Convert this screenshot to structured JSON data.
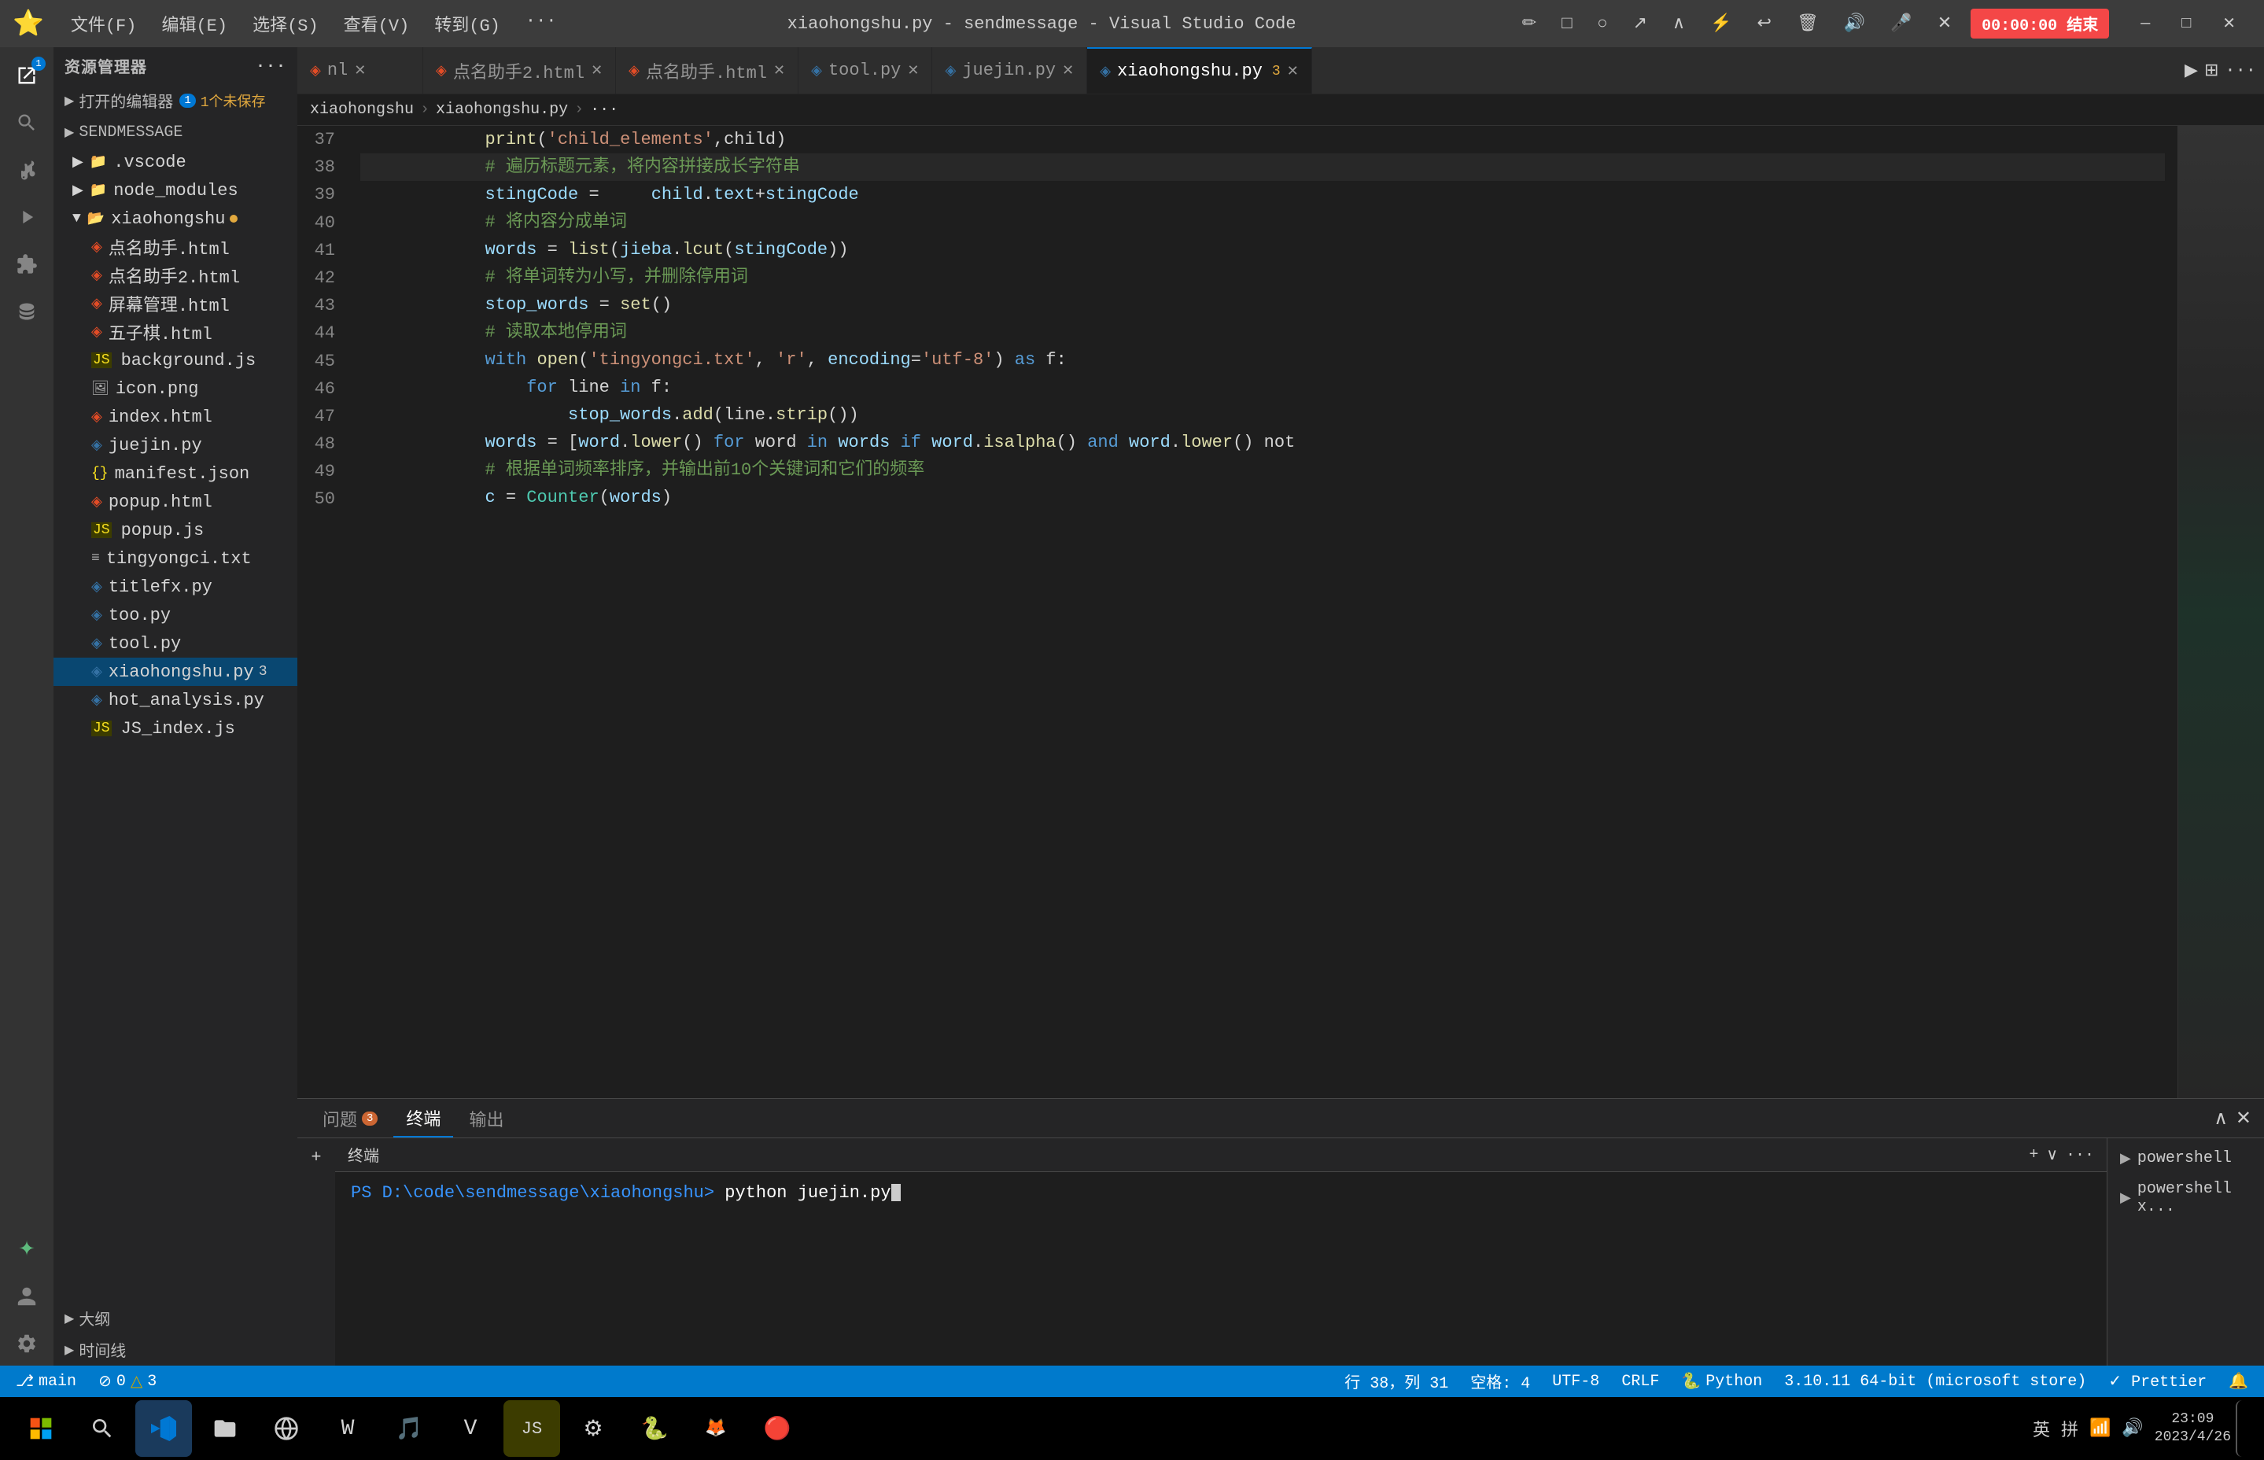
{
  "titleBar": {
    "title": "xiaohongshu.py - sendmessage - Visual Studio Code",
    "menuItems": [
      "文件(F)",
      "编辑(E)",
      "选择(S)",
      "查看(V)",
      "转到(G)",
      "···"
    ],
    "timer": "00:00:00 结束",
    "winControls": [
      "—",
      "□",
      "✕"
    ]
  },
  "activityBar": {
    "icons": [
      "explorer",
      "search",
      "source-control",
      "run-debug",
      "extensions",
      "database",
      "ai-chat",
      "account"
    ],
    "badge": "1"
  },
  "sidebar": {
    "title": "资源管理器",
    "openEditors": {
      "label": "打开的编辑器",
      "badge": "1",
      "unsaved": "1个未保存"
    },
    "rootFolder": "SENDMESSAGE",
    "items": [
      {
        "type": "folder",
        "name": ".vscode",
        "level": 1,
        "collapsed": true
      },
      {
        "type": "folder",
        "name": "node_modules",
        "level": 1,
        "collapsed": true
      },
      {
        "type": "folder",
        "name": "xiaohongshu",
        "level": 1,
        "collapsed": false,
        "dot": true
      },
      {
        "type": "html",
        "name": "点名助手.html",
        "level": 2
      },
      {
        "type": "html",
        "name": "点名助手2.html",
        "level": 2
      },
      {
        "type": "html",
        "name": "屏幕管理.html",
        "level": 2
      },
      {
        "type": "html",
        "name": "五子棋.html",
        "level": 2
      },
      {
        "type": "js",
        "name": "background.js",
        "level": 2
      },
      {
        "type": "png",
        "name": "icon.png",
        "level": 2
      },
      {
        "type": "html",
        "name": "index.html",
        "level": 2
      },
      {
        "type": "py",
        "name": "juejin.py",
        "level": 2
      },
      {
        "type": "json",
        "name": "manifest.json",
        "level": 2
      },
      {
        "type": "html",
        "name": "popup.html",
        "level": 2
      },
      {
        "type": "js",
        "name": "popup.js",
        "level": 2
      },
      {
        "type": "txt",
        "name": "tingyongci.txt",
        "level": 2
      },
      {
        "type": "py",
        "name": "titlefx.py",
        "level": 2
      },
      {
        "type": "py",
        "name": "too.py",
        "level": 2
      },
      {
        "type": "py",
        "name": "tool.py",
        "level": 2
      },
      {
        "type": "py",
        "name": "xiaohongshu.py",
        "level": 2,
        "badge": "3",
        "active": true
      },
      {
        "type": "py",
        "name": "hot_analysis.py",
        "level": 2
      },
      {
        "type": "js",
        "name": "JS_index.js",
        "level": 2
      }
    ],
    "outline": "大纲",
    "timeline": "时间线"
  },
  "tabs": [
    {
      "name": "nl",
      "type": "html",
      "active": false
    },
    {
      "name": "点名助手2.html",
      "type": "html",
      "active": false
    },
    {
      "name": "点名助手.html",
      "type": "html",
      "active": false
    },
    {
      "name": "tool.py",
      "type": "py",
      "active": false
    },
    {
      "name": "juejin.py",
      "type": "py",
      "active": false
    },
    {
      "name": "xiaohongshu.py",
      "type": "py",
      "active": true,
      "badge": "3"
    }
  ],
  "breadcrumb": [
    "xiaohongshu",
    "xiaohongshu.py",
    "···"
  ],
  "codeLines": [
    {
      "num": 37,
      "content": "            print('child_elements',child)"
    },
    {
      "num": 38,
      "content": "            # 遍历标题元素，将内容拼接成长字符串",
      "highlighted": true
    },
    {
      "num": 39,
      "content": "            stingCode =     child.text+stingCode"
    },
    {
      "num": 40,
      "content": "            # 将内容分成单词"
    },
    {
      "num": 41,
      "content": "            words = list(jieba.lcut(stingCode))"
    },
    {
      "num": 42,
      "content": "            # 将单词转为小写，并删除停用词"
    },
    {
      "num": 43,
      "content": "            stop_words = set()"
    },
    {
      "num": 44,
      "content": "            # 读取本地停用词"
    },
    {
      "num": 45,
      "content": "            with open('tingyongci.txt', 'r', encoding='utf-8') as f:"
    },
    {
      "num": 46,
      "content": "                for line in f:"
    },
    {
      "num": 47,
      "content": "                    stop_words.add(line.strip())"
    },
    {
      "num": 48,
      "content": "            words = [word.lower() for word in words if word.isalpha() and word.lower() not"
    },
    {
      "num": 49,
      "content": "            # 根据单词频率排序，并输出前10个关键词和它们的频率"
    },
    {
      "num": 50,
      "content": "            c = Counter(words)"
    }
  ],
  "panel": {
    "tabs": [
      "问题",
      "终端",
      "输出"
    ],
    "problemsBadge": "3",
    "activeTab": "终端",
    "terminalTitle": "终端",
    "prompt": "PS D:\\code\\sendmessage\\xiaohongshu>",
    "command": "python juejin.py",
    "terminals": [
      {
        "name": "powershell",
        "type": "ps"
      },
      {
        "name": "powershell x...",
        "type": "ps"
      }
    ]
  },
  "statusBar": {
    "branch": "⎇ main",
    "errors": "⊘ 0",
    "warnings": "△ 3",
    "line": "行 38，列 31",
    "spaces": "空格: 4",
    "encoding": "UTF-8",
    "lineEnding": "CRLF",
    "language": "Python",
    "pythonVersion": "3.10.11 64-bit (microsoft store)",
    "formatter": "✓ Prettier",
    "notifications": "🔔"
  },
  "taskbar": {
    "rightIcons": [
      "英",
      "拼"
    ],
    "time": "23:09",
    "date": "2023/4/26"
  }
}
